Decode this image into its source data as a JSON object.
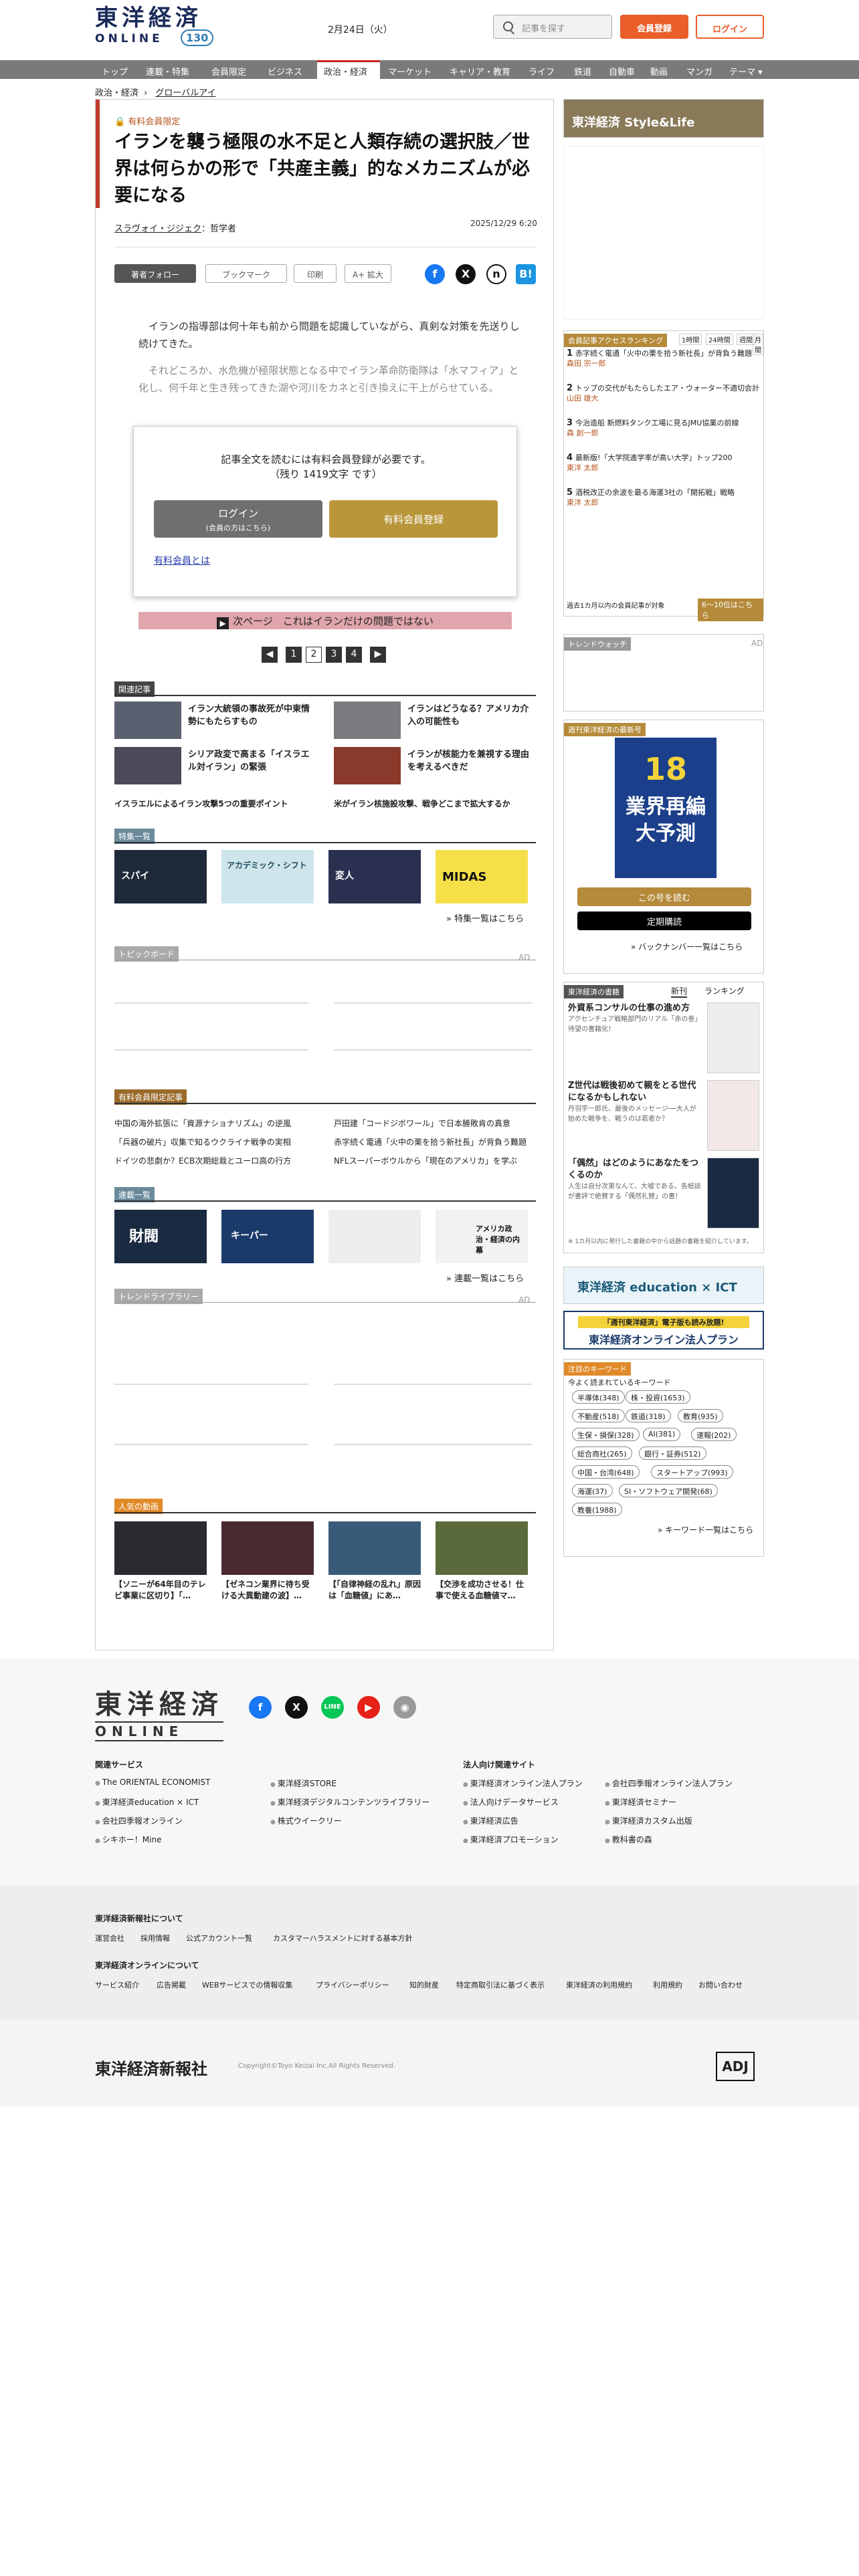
{
  "header": {
    "logo_jp": "東洋経済",
    "logo_en": "ONLINE",
    "logo_badge": "130",
    "date": "2月24日（火）",
    "search_placeholder": "記事を探す",
    "member_button": "会員登録",
    "login_button": "ログイン"
  },
  "nav": {
    "items": [
      "トップ",
      "連載・特集",
      "会員限定",
      "ビジネス",
      "政治・経済",
      "マーケット",
      "キャリア・教育",
      "ライフ",
      "鉄道",
      "自動車",
      "動画",
      "マンガ",
      "テーマ ▾"
    ],
    "active": "政治・経済"
  },
  "breadcrumb": [
    "政治・経済",
    "グローバルアイ"
  ],
  "article": {
    "premium_label": "有料会員限定",
    "title": "イランを襲う極限の水不足と人類存続の選択肢／世界は何らかの形で「共産主義」的なメカニズムが必要になる",
    "author": "スラヴォイ・ジジェク",
    "author_role": "：哲学者",
    "date": "2025/12/29 6:20",
    "tools": {
      "follow": "著者フォロー",
      "bookmark": "ブックマーク",
      "print": "印刷",
      "zoom": "A+ 拡大"
    },
    "body1": "　イランの指導部は何十年も前から問題を認識していながら、真剣な対策を先送りし続けてきた。",
    "body2": "　それどころか、水危機が極限状態となる中でイラン革命防衛隊は「水マフィア」と化し、何千年と生き残ってきた湖や河川をカネと引き換えに干上がらせている。",
    "paywall_line1": "記事全文を読むには有料会員登録が必要です。",
    "paywall_line2": "（残り 1419文字 です）",
    "paywall_login": "ログイン",
    "paywall_login_sub": "(会員の方はこちら)",
    "paywall_register": "有料会員登録",
    "paywall_what": "有料会員とは",
    "next_page": "次ページ　これはイランだけの問題ではない",
    "pages": [
      "1",
      "2",
      "3",
      "4"
    ]
  },
  "related": {
    "heading": "関連記事",
    "items": [
      "イラン大統領の事故死が中東情勢にもたらすもの",
      "イランはどうなる？アメリカ介入の可能性も",
      "シリア政変で高まる「イスラエル対イラン」の緊張",
      "イランが核能力を兼視する理由を考えるべきだ"
    ],
    "links": [
      "イスラエルによるイラン攻撃5つの重要ポイント",
      "米がイラン核施設攻撃、戦争どこまで拡大するか"
    ]
  },
  "features": {
    "heading": "特集一覧",
    "more": "特集一覧はこちら",
    "labels": [
      "スパイ",
      "アカデミック・シフト",
      "変人",
      "MIDAS"
    ]
  },
  "topics": {
    "heading": "トピックボード",
    "ad": "AD"
  },
  "premium_articles": {
    "heading": "有料会員限定記事",
    "items": [
      "中国の海外拡張に「資源ナショナリズム」の逆風",
      "戸田建「コードジボワール」で日本勝敗肯の真意",
      "「兵器の破片」収集で知るウクライナ戦争の実相",
      "赤字続く電通「火中の栗を拾う新社長」が背負う難題",
      "ドイツの悲劇か？ECB次期総裁とユーロ高の行方",
      "NFLスーパーボウルから「現在のアメリカ」を学ぶ"
    ]
  },
  "series": {
    "heading": "連載一覧",
    "more": "連載一覧はこちら",
    "labels": [
      "財閥",
      "キーパー",
      "アメリカ政治・経済の内幕"
    ]
  },
  "trend": {
    "heading": "トレンドライブラリー",
    "ad": "AD"
  },
  "videos": {
    "heading": "人気の動画",
    "items": [
      "【ソニーが64年目のテレビ事業に区切り】「…",
      "【ゼネコン業界に待ち受ける大異動建の波】…",
      "【「自律神経の乱れ」原因は「血糖値」にあ…",
      "【交渉を成功させる！仕事で使える血糖値マ…"
    ]
  },
  "sidebar": {
    "banner_style": "東洋経済 Style&Life",
    "ranking_heading": "会員記事アクセスランキング",
    "ranking_tabs": [
      "1時間",
      "24時間",
      "週間",
      "月間"
    ],
    "ranking": [
      {
        "rank": "1",
        "title": "赤字続く電通「火中の栗を拾う新社長」が背負う難題",
        "author": "森田 宗一郎"
      },
      {
        "rank": "2",
        "title": "トップの交代がもたらしたエア・ウォーター不適切会計",
        "author": "山田 雄大"
      },
      {
        "rank": "3",
        "title": "今治造船 新燃料タンク工場に見るJMU協業の前線",
        "author": "森 創一郎"
      },
      {
        "rank": "4",
        "title": "最新版!「大学院進学率が高い大学」トップ200",
        "author": "東洋 太郎"
      },
      {
        "rank": "5",
        "title": "酒税改正の余波を最る海運3社の「開拓戦」戦略",
        "author": "東洋 太郎"
      }
    ],
    "ranking_note": "過去1カ月以内の会員記事が対象",
    "ranking_more": "6～10位はこちら",
    "trendwatch_heading": "トレンドウォッチ",
    "trendwatch_ad": "AD",
    "weekly_heading": "週刊東洋経済の最新号",
    "weekly_cover_title": "業界再編 大予測",
    "weekly_cover_num": "18",
    "weekly_read": "この号を読む",
    "weekly_subscribe": "定期購読",
    "weekly_backnumber": "バックナンバー一覧はこちら",
    "books_heading": "東洋経済の書籍",
    "books_tabs": [
      "新刊",
      "ランキング"
    ],
    "books": [
      {
        "title": "外資系コンサルの仕事の進め方",
        "desc": "アクセンチュア戦略部門のリアル「赤の巻」待望の書籍化！"
      },
      {
        "title": "Z世代は戦後初めて親をとる世代になるかもしれない",
        "desc": "丹羽宇一郎氏、最後のメッセージ──大人が始めた戦争を、戦うのは若者か？"
      },
      {
        "title": "「偶然」はどのようにあなたをつくるのか",
        "desc": "人生は自分次第なんて、大嘘である。各紙誌が書評で絶賛する「偶然礼賛」の書！"
      }
    ],
    "books_note": "※ 1カ月以内に発行した書籍の中から話題の書籍を紹介しています。",
    "edu_banner": "東洋経済 education × ICT",
    "corp_banner_top": "「週刊東洋経済」電子版も読み放題!",
    "corp_banner": "東洋経済オンライン法人プラン",
    "keyword_heading": "注目のキーワード",
    "keyword_sub": "今よく読まれているキーワード",
    "keywords": [
      "半導体(348)",
      "株・投資(1653)",
      "不動産(518)",
      "鉄道(318)",
      "教育(935)",
      "生保・損保(328)",
      "AI(381)",
      "速報(202)",
      "総合商社(265)",
      "銀行・証券(512)",
      "中国・台湾(648)",
      "スタートアップ(993)",
      "海運(37)",
      "SI・ソフトウェア開発(68)",
      "教養(1988)"
    ],
    "keyword_more": "キーワード一覧はこちら"
  },
  "footer": {
    "logo_jp": "東洋経済",
    "logo_en": "ONLINE",
    "related_heading": "関連サービス",
    "related_col1": [
      "The ORIENTAL ECONOMIST",
      "東洋経済education × ICT",
      "会社四季報オンライン",
      "シキホー！Mine"
    ],
    "related_col2": [
      "東洋経済STORE",
      "東洋経済デジタルコンテンツライブラリー",
      "株式ウイークリー"
    ],
    "corp_heading": "法人向け関連サイト",
    "corp_col1": [
      "東洋経済オンライン法人プラン",
      "法人向けデータサービス",
      "東洋経済広告",
      "東洋経済プロモーション"
    ],
    "corp_col2": [
      "会社四季報オンライン法人プラン",
      "東洋経済セミナー",
      "東洋経済カスタム出版",
      "教科書の森"
    ],
    "about_company_heading": "東洋経済新報社について",
    "about_company_links": [
      "運営会社",
      "採用情報",
      "公式アカウント一覧",
      "カスタマーハラスメントに対する基本方針"
    ],
    "about_online_heading": "東洋経済オンラインについて",
    "about_online_links": [
      "サービス紹介",
      "広告掲載",
      "WEBサービスでの情報収集",
      "プライバシーポリシー",
      "知的財産",
      "特定商取引法に基づく表示",
      "東洋経済の利用規約",
      "利用規約",
      "お問い合わせ"
    ],
    "company_logo": "東洋経済新報社",
    "copyright": "Copyright©Toyo Keizai Inc.All Rights Reserved.",
    "adj_badge": "ADJ"
  }
}
